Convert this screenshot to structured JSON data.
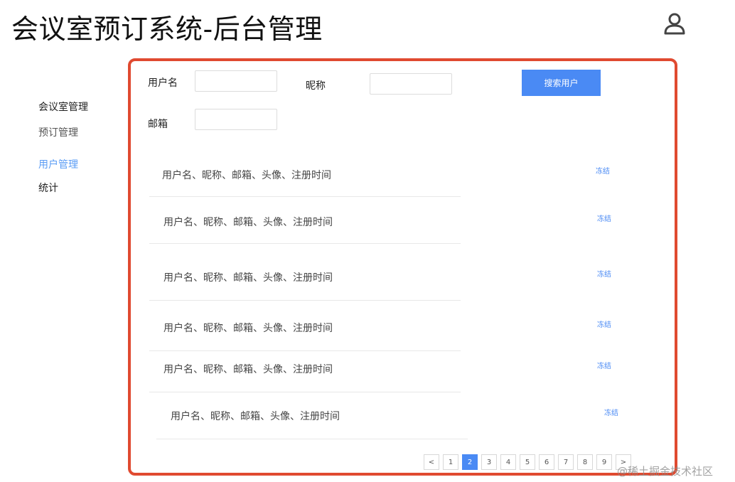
{
  "app": {
    "title": "会议室预订系统-后台管理"
  },
  "header": {
    "user_icon": "user-icon"
  },
  "sidebar": {
    "items": [
      {
        "label": "会议室管理"
      },
      {
        "label": "预订管理"
      },
      {
        "label": "用户管理",
        "active": true
      },
      {
        "label": "统计"
      }
    ]
  },
  "search": {
    "username_label": "用户名",
    "nickname_label": "昵称",
    "email_label": "邮箱",
    "username_value": "",
    "nickname_value": "",
    "email_value": "",
    "button_label": "搜索用户"
  },
  "list": {
    "rows": [
      {
        "text": "用户名、昵称、邮箱、头像、注册时间",
        "action": "冻结"
      },
      {
        "text": "用户名、昵称、邮箱、头像、注册时间",
        "action": "冻结"
      },
      {
        "text": "用户名、昵称、邮箱、头像、注册时间",
        "action": "冻结"
      },
      {
        "text": "用户名、昵称、邮箱、头像、注册时间",
        "action": "冻结"
      },
      {
        "text": "用户名、昵称、邮箱、头像、注册时间",
        "action": "冻结"
      },
      {
        "text": "用户名、昵称、邮箱、头像、注册时间",
        "action": "冻结"
      }
    ]
  },
  "pagination": {
    "prev": "<",
    "pages": [
      "1",
      "2",
      "3",
      "4",
      "5",
      "6",
      "7",
      "8",
      "9"
    ],
    "current": "2",
    "next": ">"
  },
  "colors": {
    "accent": "#4a8af4",
    "frame": "#e04a30",
    "active_nav": "#5a9cf5"
  },
  "watermark": "@稀土掘金技术社区"
}
